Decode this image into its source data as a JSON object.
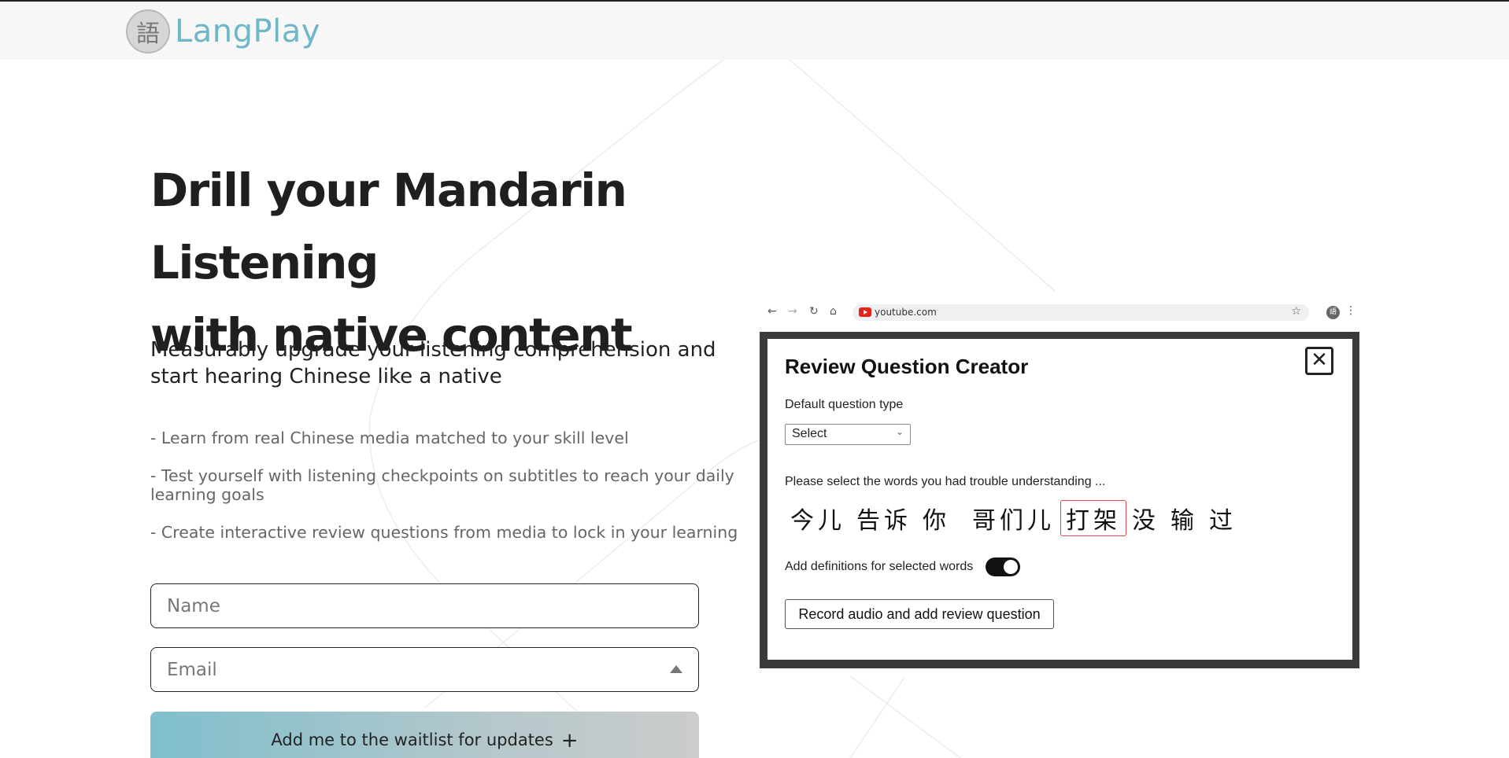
{
  "header": {
    "logo_glyph": "語",
    "brand_name": "LangPlay"
  },
  "hero": {
    "title_line1": "Drill your Mandarin Listening",
    "title_line2": "with native content",
    "subtitle": "Measurably upgrade your listening comprehension and start hearing Chinese like a native",
    "bullets": [
      "- Learn from real Chinese media matched to your skill level",
      "- Test yourself with listening checkpoints on subtitles to reach your daily learning goals",
      "- Create interactive review questions from media to lock in your learning"
    ]
  },
  "form": {
    "name_placeholder": "Name",
    "email_placeholder": "Email",
    "submit_label": "Add me to the waitlist for updates",
    "submit_icon": "+"
  },
  "browser_mock": {
    "url": "youtube.com",
    "ext_glyph": "語"
  },
  "dialog": {
    "title": "Review Question Creator",
    "close_glyph": "✕",
    "question_type_label": "Default question type",
    "question_type_value": "Select",
    "words_prompt": "Please select the words you had trouble understanding ...",
    "words": [
      {
        "text": "今儿",
        "selected": false
      },
      {
        "text": "告诉",
        "selected": false
      },
      {
        "text": "你",
        "selected": false
      },
      {
        "text": "哥们儿",
        "selected": false
      },
      {
        "text": "打架",
        "selected": true
      },
      {
        "text": "没",
        "selected": false
      },
      {
        "text": "输",
        "selected": false
      },
      {
        "text": "过",
        "selected": false
      }
    ],
    "definitions_toggle_label": "Add definitions for selected words",
    "definitions_toggle_on": true,
    "record_button_label": "Record audio and add review question"
  },
  "colors": {
    "brand": "#6fb7c6",
    "selected_word_border": "#d94a4a",
    "toggle_on": "#111111"
  }
}
